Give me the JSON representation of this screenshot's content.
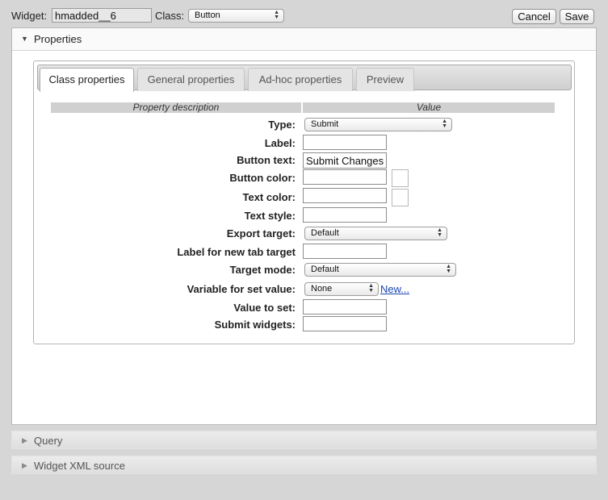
{
  "header": {
    "widget_label": "Widget:",
    "widget_value": "hmadded__6",
    "class_label": "Class:",
    "class_value": "Button",
    "cancel_label": "Cancel",
    "save_label": "Save"
  },
  "properties_panel": {
    "title": "Properties",
    "tabs": [
      {
        "label": "Class properties",
        "active": true
      },
      {
        "label": "General properties",
        "active": false
      },
      {
        "label": "Ad-hoc properties",
        "active": false
      },
      {
        "label": "Preview",
        "active": false
      }
    ],
    "columns": {
      "description": "Property description",
      "value": "Value"
    },
    "rows": {
      "type": {
        "label": "Type:",
        "value": "Submit"
      },
      "label": {
        "label": "Label:",
        "value": ""
      },
      "button_text": {
        "label": "Button text:",
        "value": "Submit Changes"
      },
      "button_color": {
        "label": "Button color:",
        "value": ""
      },
      "text_color": {
        "label": "Text color:",
        "value": ""
      },
      "text_style": {
        "label": "Text style:",
        "value": ""
      },
      "export_target": {
        "label": "Export target:",
        "value": "Default"
      },
      "label_new_tab": {
        "label": "Label for new tab target",
        "value": ""
      },
      "target_mode": {
        "label": "Target mode:",
        "value": "Default"
      },
      "variable_set_value": {
        "label": "Variable for set value:",
        "value": "None",
        "link": "New..."
      },
      "value_to_set": {
        "label": "Value to set:",
        "value": ""
      },
      "submit_widgets": {
        "label": "Submit widgets:",
        "value": ""
      }
    }
  },
  "query_panel": {
    "title": "Query"
  },
  "xml_panel": {
    "title": "Widget XML source"
  },
  "colors": {
    "background": "#d6d6d6",
    "panel": "#ffffff",
    "link": "#1a45b3"
  }
}
